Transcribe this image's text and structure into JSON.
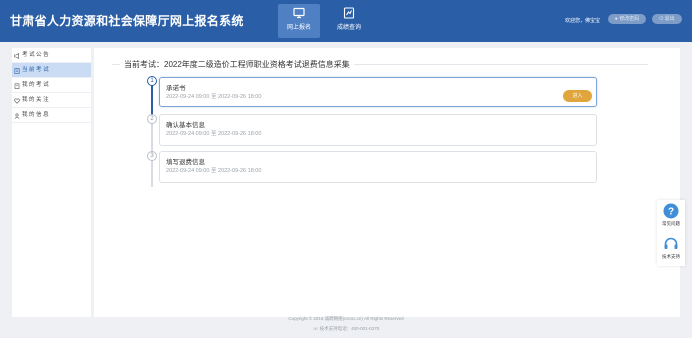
{
  "header": {
    "title": "甘肃省人力资源和社会保障厅网上报名系统",
    "nav": [
      {
        "label": "网上报名",
        "icon": "monitor-icon",
        "active": true
      },
      {
        "label": "成绩查询",
        "icon": "score-icon",
        "active": false
      }
    ],
    "welcome": "欢迎您，佛宝宝",
    "change_password": "修改密码",
    "logout": "退出"
  },
  "sidebar": {
    "items": [
      {
        "label": "考 试 公 告",
        "icon": "megaphone-icon",
        "active": false
      },
      {
        "label": "当 前 考 试",
        "icon": "book-icon",
        "active": true
      },
      {
        "label": "我 的 考 试",
        "icon": "clipboard-icon",
        "active": false
      },
      {
        "label": "我 的 关 注",
        "icon": "heart-icon",
        "active": false
      },
      {
        "label": "我 的 信 息",
        "icon": "user-icon",
        "active": false
      }
    ]
  },
  "main": {
    "exam_title": "当前考试：2022年度二级造价工程师职业资格考试退费信息采集",
    "steps": [
      {
        "number": "1",
        "title": "承诺书",
        "time": "2022-09-24 09:00 至 2022-09-26 18:00",
        "active": true,
        "button": "进入"
      },
      {
        "number": "2",
        "title": "确认基本信息",
        "time": "2022-09-24 09:00 至 2022-09-26 18:00",
        "active": false
      },
      {
        "number": "3",
        "title": "填写退费信息",
        "time": "2022-09-24 09:00 至 2022-09-26 18:00",
        "active": false
      }
    ]
  },
  "float_help": {
    "faq": "常见问题",
    "support": "技术支持"
  },
  "footer": {
    "copyright": "Copyright © 2016 诚聘网络(cscsc.cn) All Rights Reserved",
    "tel": "☏ 技术支持电话：400-001-0370"
  },
  "colors": {
    "header_bg": "#2a5fa8",
    "accent_button": "#e0a53d",
    "sidebar_active": "#c9dcf3"
  }
}
